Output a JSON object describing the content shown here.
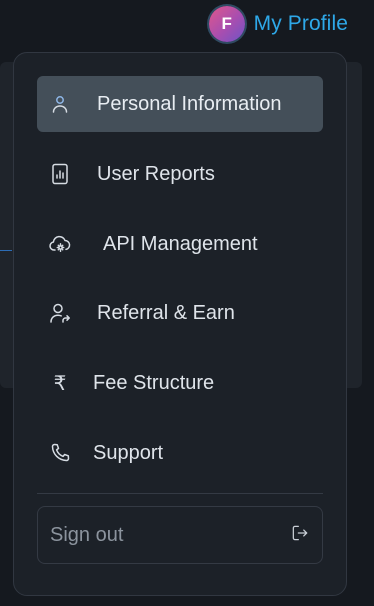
{
  "header": {
    "avatar_initial": "F",
    "profile_label": "My Profile"
  },
  "menu": {
    "items": [
      {
        "label": "Personal Information",
        "icon": "user-icon",
        "active": true
      },
      {
        "label": "User Reports",
        "icon": "report-icon",
        "active": false
      },
      {
        "label": "API Management",
        "icon": "cloud-settings-icon",
        "active": false
      },
      {
        "label": "Referral & Earn",
        "icon": "user-share-icon",
        "active": false
      },
      {
        "label": "Fee Structure",
        "icon": "rupee-icon",
        "active": false
      },
      {
        "label": "Support",
        "icon": "phone-icon",
        "active": false
      }
    ],
    "signout_label": "Sign out",
    "signout_icon": "logout-icon"
  },
  "colors": {
    "accent": "#2ea8e8",
    "active_item_bg": "#444f59",
    "dropdown_bg": "#1c2128"
  }
}
